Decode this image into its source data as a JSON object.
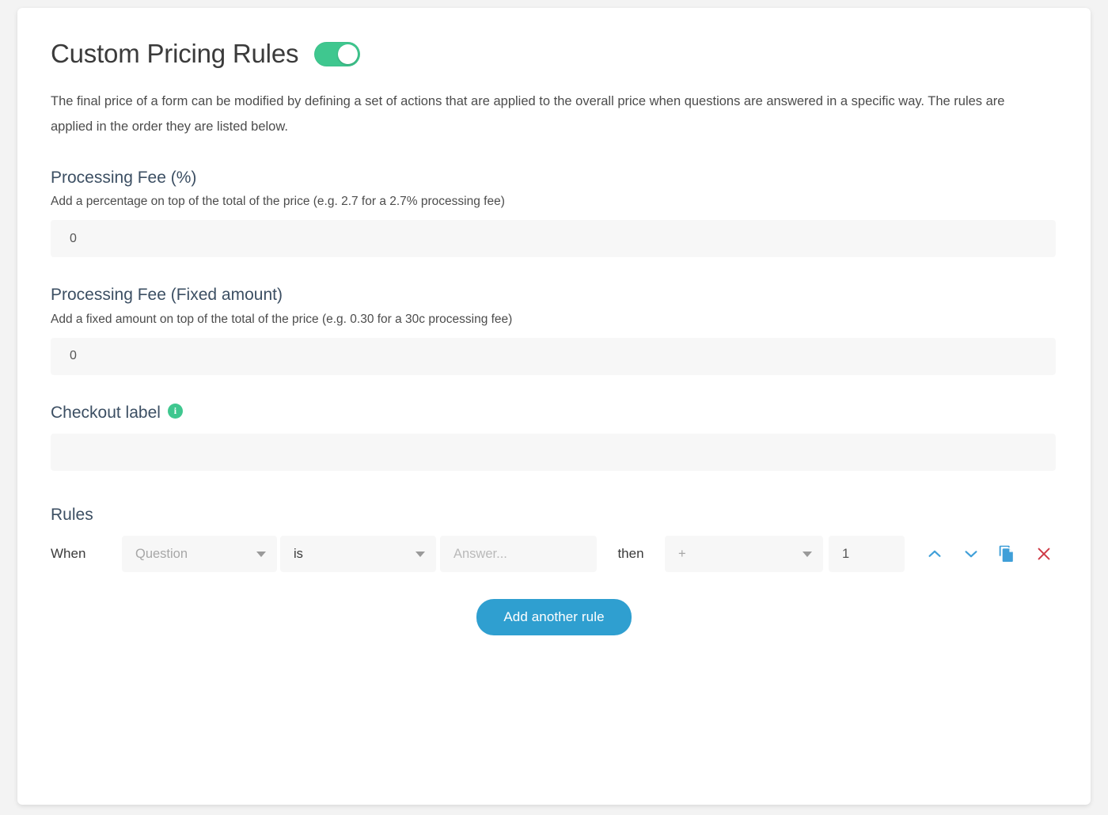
{
  "header": {
    "title": "Custom Pricing Rules",
    "toggle_state": "on",
    "toggle_color": "#3fc78f"
  },
  "intro": "The final price of a form can be modified by defining a set of actions that are applied to the overall price when questions are answered in a specific way. The rules are applied in the order they are listed below.",
  "fields": {
    "processing_fee_percent": {
      "label": "Processing Fee (%)",
      "help": "Add a percentage on top of the total of the price (e.g. 2.7 for a 2.7% processing fee)",
      "value": "0",
      "placeholder": ""
    },
    "processing_fee_fixed": {
      "label": "Processing Fee (Fixed amount)",
      "help": "Add a fixed amount on top of the total of the price (e.g. 0.30 for a 30c processing fee)",
      "value": "0",
      "placeholder": ""
    },
    "checkout_label": {
      "label": "Checkout label",
      "info_icon": "info-icon",
      "value": "",
      "placeholder": ""
    }
  },
  "rules": {
    "heading": "Rules",
    "when_word": "When",
    "then_word": "then",
    "rows": [
      {
        "question_value": "Question",
        "operator_value": "is",
        "answer_value": "",
        "answer_placeholder": "Answer...",
        "action_value": "+",
        "amount_value": "1"
      }
    ],
    "icons": {
      "move_up": "chevron-up-icon",
      "move_down": "chevron-down-icon",
      "duplicate": "copy-icon",
      "delete": "close-x-icon"
    },
    "add_button_label": "Add another rule"
  },
  "colors": {
    "accent_blue": "#2f9fd0",
    "accent_green": "#3fc78f",
    "delete_red": "#cf3b47",
    "heading_slate": "#3c4f63"
  }
}
